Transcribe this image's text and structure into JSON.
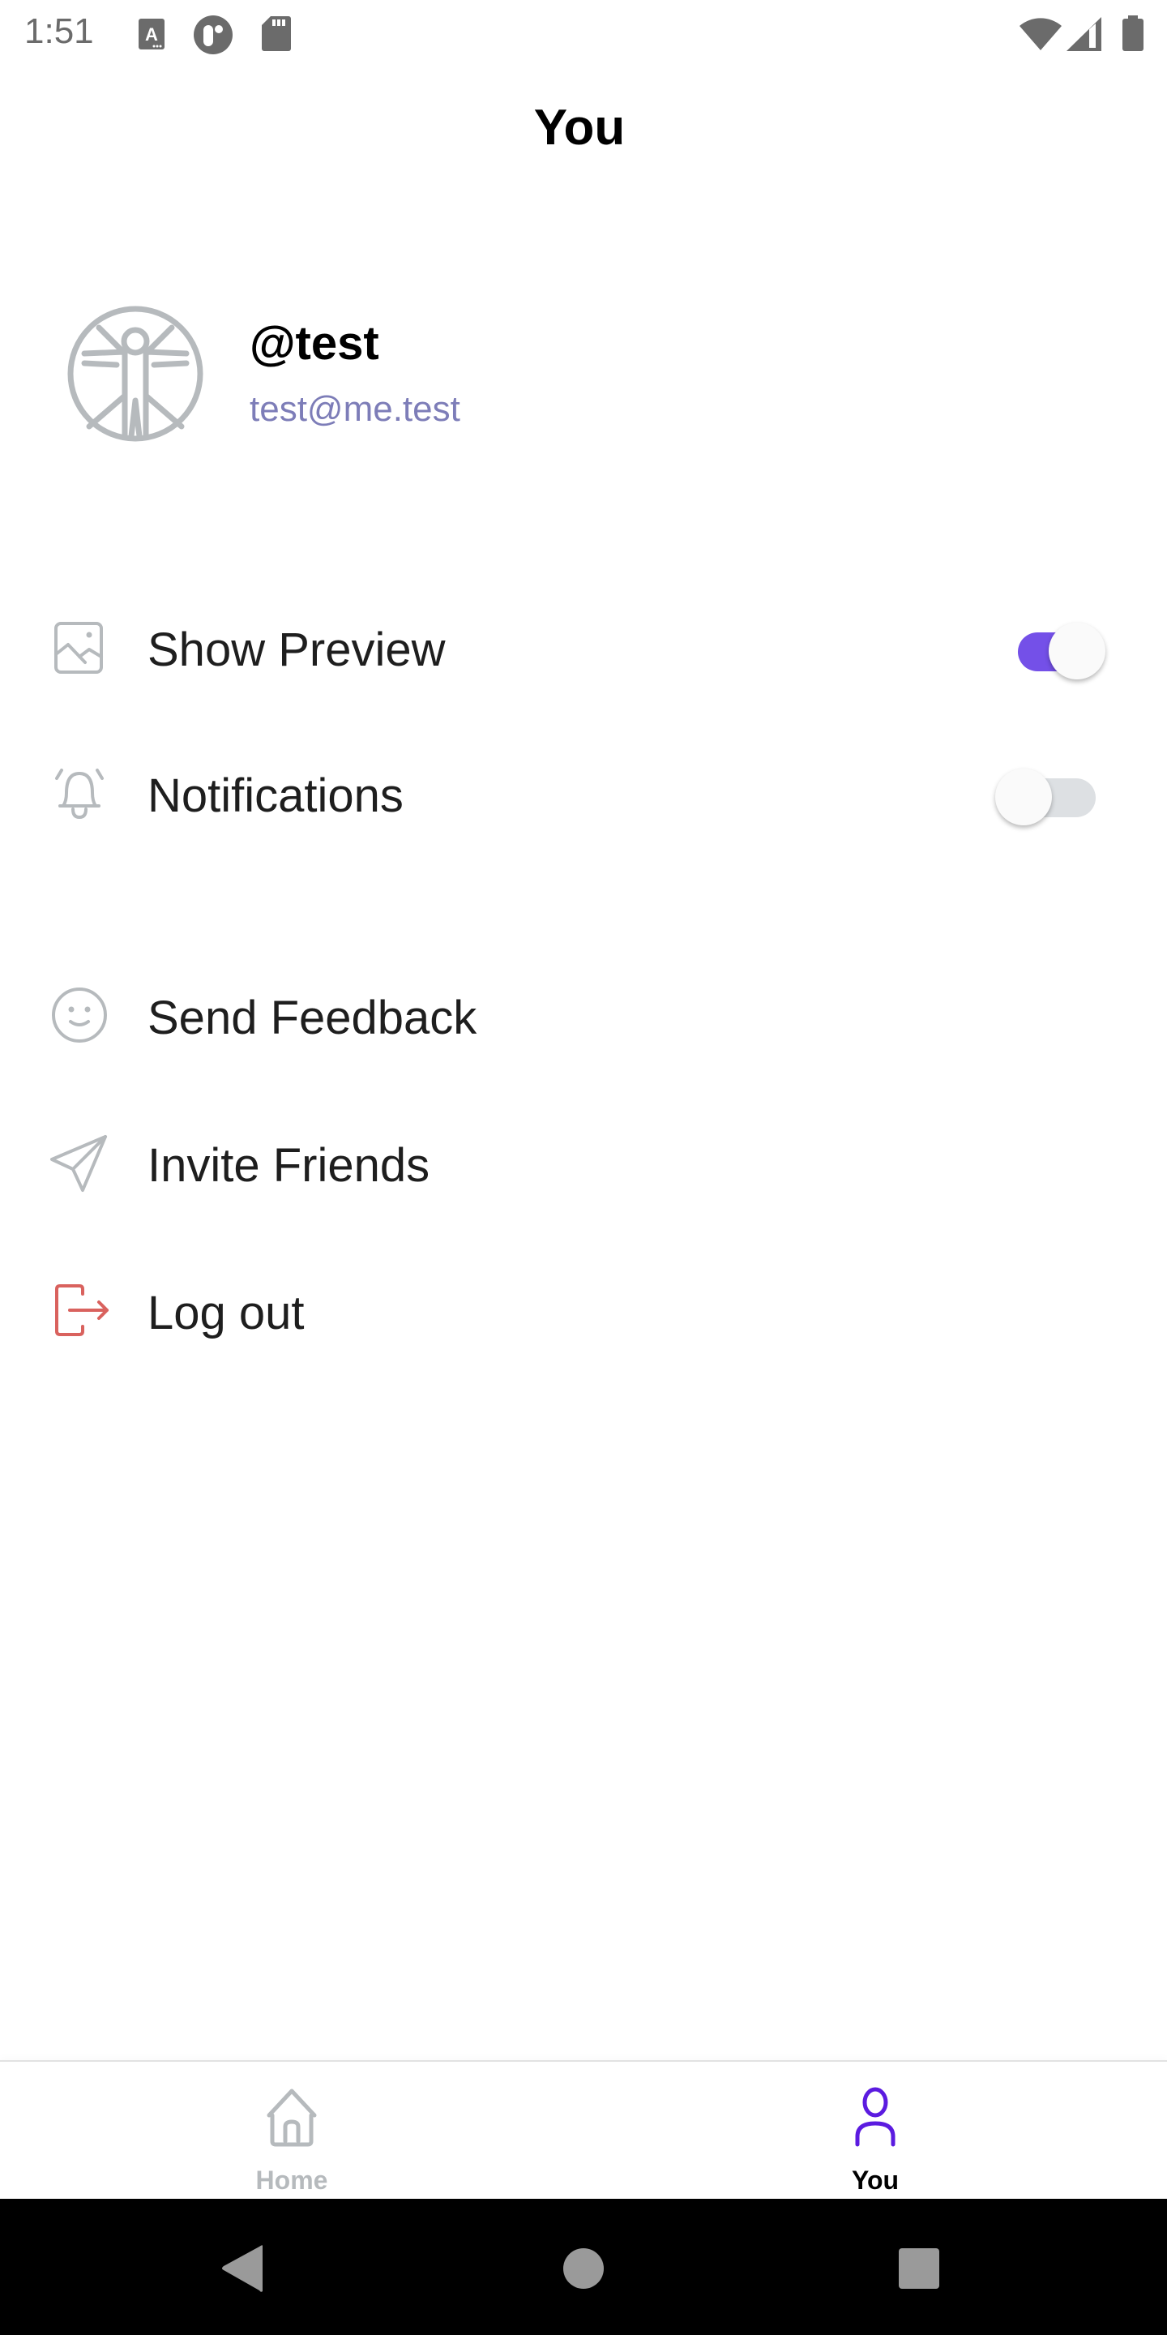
{
  "status_bar": {
    "time": "1:51",
    "left_icons": [
      "autofill-a-icon",
      "app-notification-icon",
      "sd-card-icon"
    ],
    "right_icons": [
      "wifi-icon",
      "cell-signal-icon",
      "battery-icon"
    ]
  },
  "header": {
    "title": "You"
  },
  "profile": {
    "avatar_icon": "vitruvian-man-icon",
    "username": "@test",
    "email": "test@me.test"
  },
  "settings": [
    {
      "icon": "image-icon",
      "label": "Show Preview",
      "toggle": true
    },
    {
      "icon": "bell-icon",
      "label": "Notifications",
      "toggle": false
    }
  ],
  "actions": [
    {
      "icon": "smiley-icon",
      "label": "Send Feedback"
    },
    {
      "icon": "paper-plane-icon",
      "label": "Invite Friends"
    },
    {
      "icon": "logout-icon",
      "label": "Log out"
    }
  ],
  "bottom_nav": {
    "items": [
      {
        "icon": "home-icon",
        "label": "Home",
        "active": false
      },
      {
        "icon": "person-icon",
        "label": "You",
        "active": true
      }
    ]
  },
  "system_nav": [
    "back-icon",
    "home-circle-icon",
    "recents-icon"
  ],
  "colors": {
    "accent": "#7450e8",
    "nav_active": "#5b1be0",
    "icon_gray": "#b6babd",
    "danger": "#d9625e",
    "email": "#7d7db8"
  }
}
